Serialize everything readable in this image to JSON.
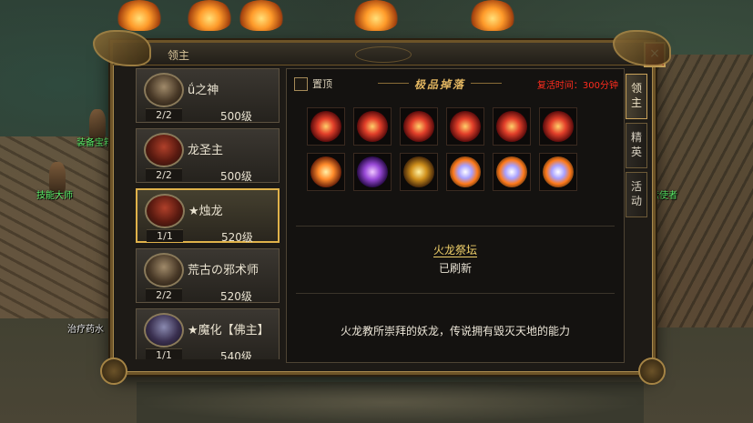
{
  "window": {
    "title": "领主",
    "close": "×"
  },
  "bosses": [
    {
      "count": "2/2",
      "name": "ǘ之神",
      "level": "500级",
      "portrait": "grey"
    },
    {
      "count": "2/2",
      "name": "龙圣主",
      "level": "500级",
      "portrait": "red"
    },
    {
      "count": "1/1",
      "name": "★烛龙",
      "level": "520级",
      "portrait": "red",
      "selected": true
    },
    {
      "count": "2/2",
      "name": "荒古の邪术师",
      "level": "520级",
      "portrait": "grey"
    },
    {
      "count": "1/1",
      "name": "★魔化【佛主】",
      "level": "540级",
      "portrait": "blue"
    }
  ],
  "content": {
    "pin_label": "置顶",
    "drops_title": "极品掉落",
    "respawn": "复活时间：300分钟",
    "location_name": "火龙祭坛",
    "status": "已刷新",
    "description": "火龙教所崇拜的妖龙，传说拥有毁灭天地的能力"
  },
  "drop_items": [
    {
      "name": "red-rune-icon",
      "style": "g-red"
    },
    {
      "name": "red-rune-icon",
      "style": "g-red"
    },
    {
      "name": "red-rune-icon",
      "style": "g-red"
    },
    {
      "name": "red-rune-icon",
      "style": "g-red"
    },
    {
      "name": "red-rune-icon",
      "style": "g-red"
    },
    {
      "name": "red-rune-icon",
      "style": "g-red"
    },
    {
      "name": "fire-ring-icon",
      "style": "g-orange"
    },
    {
      "name": "purple-crown-icon",
      "style": "g-purple"
    },
    {
      "name": "gold-armor-icon",
      "style": "g-gold"
    },
    {
      "name": "fire-orb-icon",
      "style": "g-blue"
    },
    {
      "name": "fire-orb-icon",
      "style": "g-blue"
    },
    {
      "name": "fire-orb-icon",
      "style": "g-blue"
    }
  ],
  "tabs": [
    {
      "label": "领\n主",
      "active": true
    },
    {
      "label": "精\n英",
      "active": false
    },
    {
      "label": "活\n动",
      "active": false
    }
  ],
  "npcs": {
    "equip": "装备宝箱",
    "skill": "技能大师",
    "heal": "治疗药水",
    "prison": "狱使者"
  }
}
